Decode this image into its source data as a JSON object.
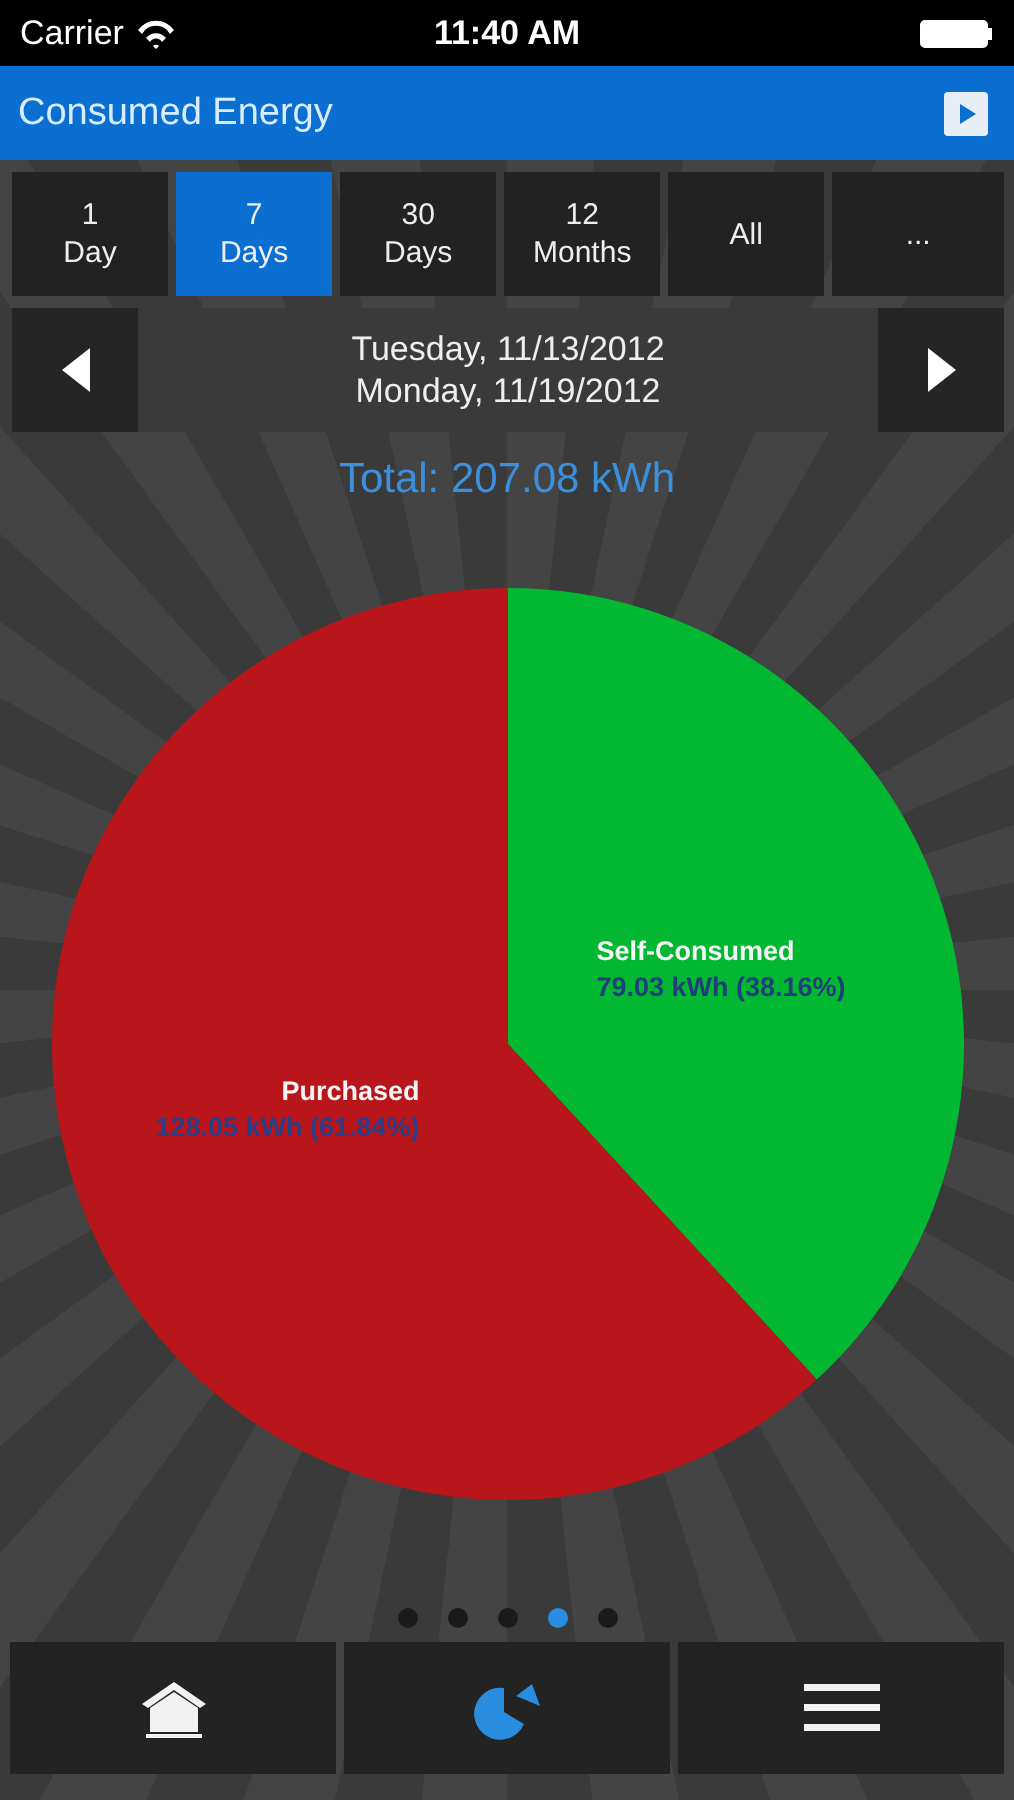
{
  "status_bar": {
    "carrier": "Carrier",
    "time": "11:40 AM"
  },
  "header": {
    "title": "Consumed Energy"
  },
  "ranges": [
    {
      "label": "1\nDay",
      "selected": false
    },
    {
      "label": "7\nDays",
      "selected": true
    },
    {
      "label": "30\nDays",
      "selected": false
    },
    {
      "label": "12\nMonths",
      "selected": false
    },
    {
      "label": "All",
      "selected": false
    },
    {
      "label": "...",
      "selected": false
    }
  ],
  "date_range": {
    "lines": [
      "Tuesday, 11/13/2012",
      "Monday, 11/19/2012"
    ]
  },
  "total": "Total: 207.08 kWh",
  "chart_data": {
    "type": "pie",
    "categories": [
      "Self-Consumed",
      "Purchased"
    ],
    "values": [
      38.16,
      61.84
    ],
    "colors": [
      "#02b832",
      "#b8161a"
    ],
    "value_labels": [
      "79.03 kWh (38.16%)",
      "128.05 kWh (61.84%)"
    ]
  },
  "page_dots": [
    {
      "selected": false
    },
    {
      "selected": false
    },
    {
      "selected": false
    },
    {
      "selected": true
    },
    {
      "selected": false
    }
  ],
  "tab_bar": [
    {
      "kind": "home",
      "selected": false
    },
    {
      "kind": "chart",
      "selected": true
    },
    {
      "kind": "menu",
      "selected": false
    }
  ]
}
